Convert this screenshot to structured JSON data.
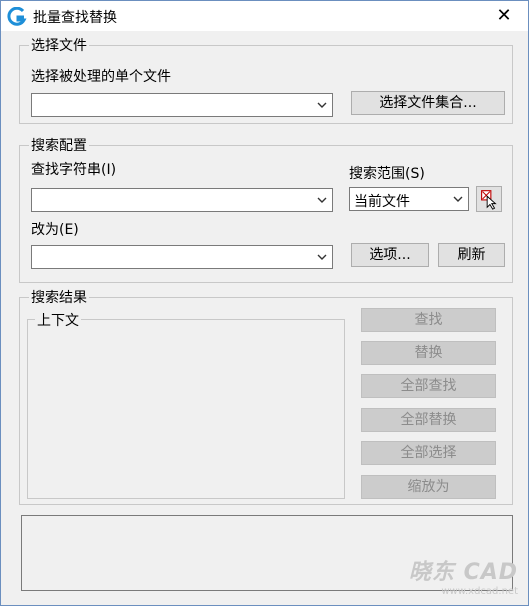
{
  "window": {
    "title": "批量查找替换",
    "close_symbol": "✕",
    "icon": "app-logo-icon"
  },
  "select_file": {
    "group_title": "选择文件",
    "label": "选择被处理的单个文件",
    "file_value": "",
    "collection_button": "选择文件集合..."
  },
  "search_config": {
    "group_title": "搜索配置",
    "find_label": "查找字符串(I)",
    "find_value": "",
    "scope_label": "搜索范围(S)",
    "scope_value": "当前文件",
    "replace_label": "改为(E)",
    "replace_value": "",
    "options_button": "选项...",
    "refresh_button": "刷新",
    "pick_icon": "select-objects-icon"
  },
  "results": {
    "group_title": "搜索结果",
    "context_label": "上下文",
    "buttons": {
      "find": "查找",
      "replace": "替换",
      "find_all": "全部查找",
      "replace_all": "全部替换",
      "select_all": "全部选择",
      "zoom_to": "缩放为"
    }
  },
  "watermark": {
    "brand": "晓东 CAD",
    "url": "www.xdcad.net"
  },
  "colors": {
    "window_bg": "#f0f0f0",
    "button_bg": "#e1e1e1",
    "disabled_text": "#8c8c8c",
    "icon_blue": "#1e8fd8"
  }
}
